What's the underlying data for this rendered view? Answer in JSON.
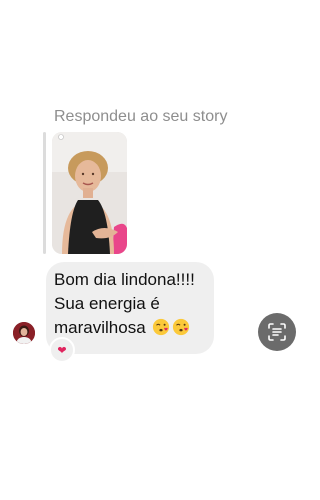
{
  "reply": {
    "label": "Respondeu ao seu story"
  },
  "message": {
    "lines": [
      "Bom dia lindona!!!!",
      "Sua energia é",
      "maravilhosa"
    ],
    "emojis": [
      "kissing-face-with-heart-emoji",
      "kissing-face-with-heart-emoji"
    ]
  },
  "reaction": {
    "glyph": "❤"
  },
  "colors": {
    "bubble": "#efefef",
    "muted_text": "#8e8e8e",
    "heart": "#e0245e",
    "scan_button": "#6b6b6b"
  }
}
